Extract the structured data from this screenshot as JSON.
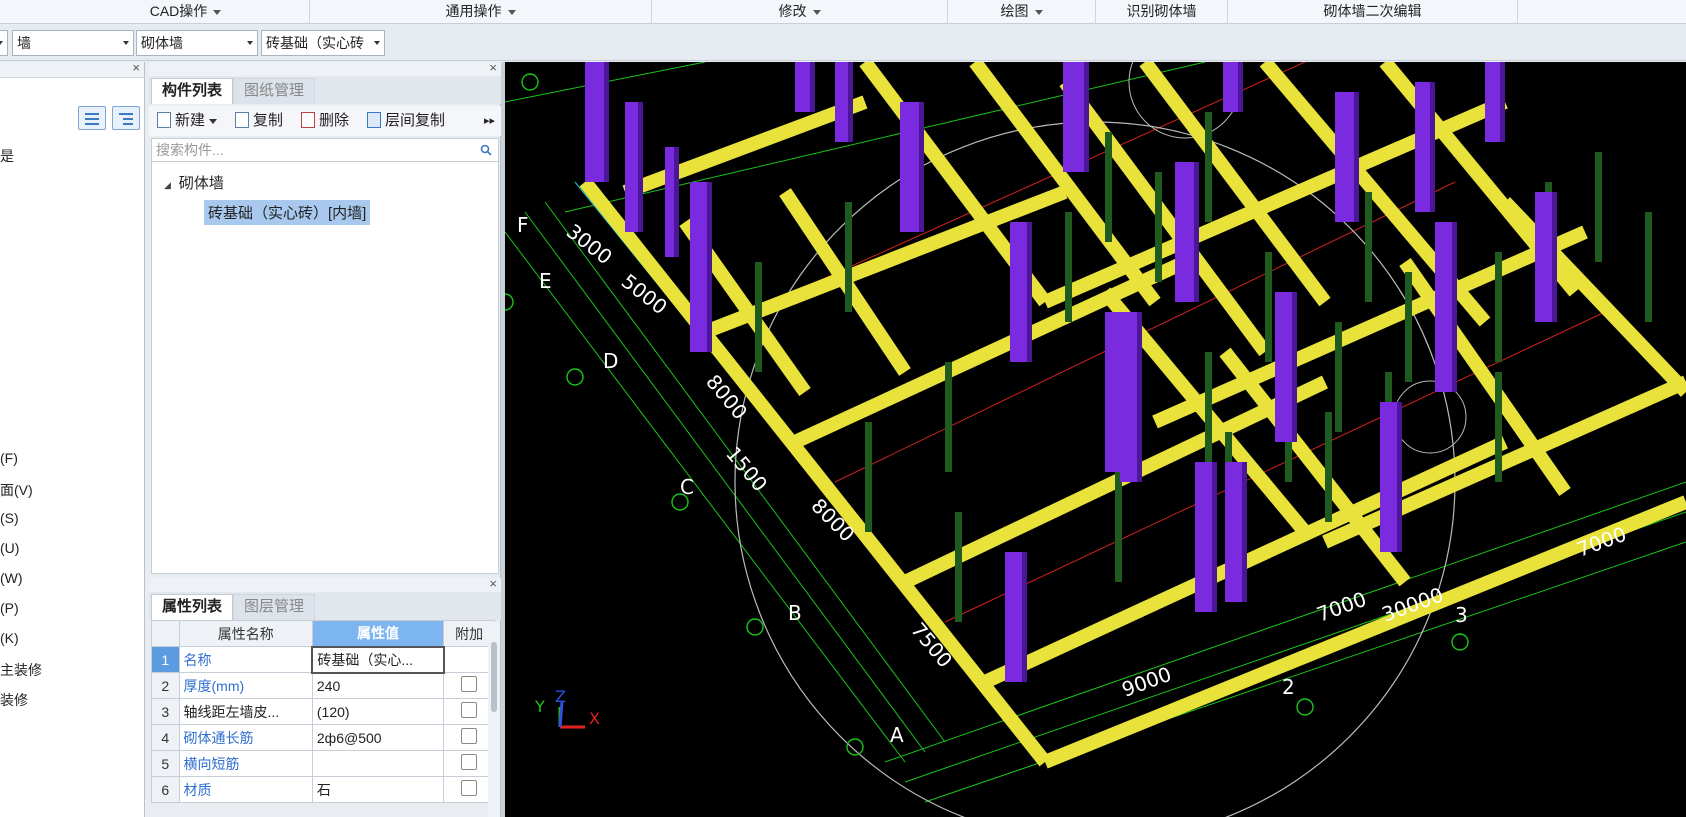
{
  "ribbon": {
    "groups": [
      "CAD操作",
      "通用操作",
      "修改",
      "绘图",
      "识别砌体墙",
      "砌体墙二次编辑"
    ]
  },
  "selectors": {
    "category": "墙",
    "type": "砌体墙",
    "component": "砖基础（实心砖"
  },
  "left_panel": {
    "items": [
      "(F)",
      "面(V)",
      "(S)",
      "(U)",
      "(W)",
      "(P)",
      "(K)",
      "主装修",
      "装修"
    ],
    "partial_label": "是"
  },
  "component_panel": {
    "tabs": [
      "构件列表",
      "图纸管理"
    ],
    "toolbar": {
      "new": "新建",
      "copy": "复制",
      "delete": "删除",
      "floor_copy": "层间复制"
    },
    "search_placeholder": "搜索构件...",
    "tree": {
      "root": "砌体墙",
      "child": "砖基础（实心砖）[内墙]"
    }
  },
  "property_panel": {
    "tabs": [
      "属性列表",
      "图层管理"
    ],
    "headers": [
      "属性名称",
      "属性值",
      "附加"
    ],
    "rows": [
      {
        "no": "1",
        "name": "名称",
        "value": "砖基础（实心...",
        "blue": true
      },
      {
        "no": "2",
        "name": "厚度(mm)",
        "value": "240",
        "blue": true
      },
      {
        "no": "3",
        "name": "轴线距左墙皮...",
        "value": "(120)",
        "blue": false
      },
      {
        "no": "4",
        "name": "砌体通长筋",
        "value": "2ф6@500",
        "blue": true
      },
      {
        "no": "5",
        "name": "横向短筋",
        "value": "",
        "blue": true
      },
      {
        "no": "6",
        "name": "材质",
        "value": "石",
        "blue": true
      }
    ]
  },
  "cad": {
    "dims": [
      "3000",
      "5000",
      "8000",
      "1500",
      "8000",
      "7500",
      "9000",
      "7000",
      "7000",
      "30000"
    ],
    "axes_letters": [
      "F",
      "E",
      "D",
      "C",
      "B",
      "A"
    ],
    "axes_numbers": [
      "2",
      "3"
    ],
    "ucs": {
      "x": "X",
      "y": "Y",
      "z": "Z"
    },
    "colors": {
      "wall": "#e8e23a",
      "column": "#7a2be0",
      "post": "#1f5a1f",
      "grid": "#19c419",
      "text": "#ffffff"
    }
  }
}
